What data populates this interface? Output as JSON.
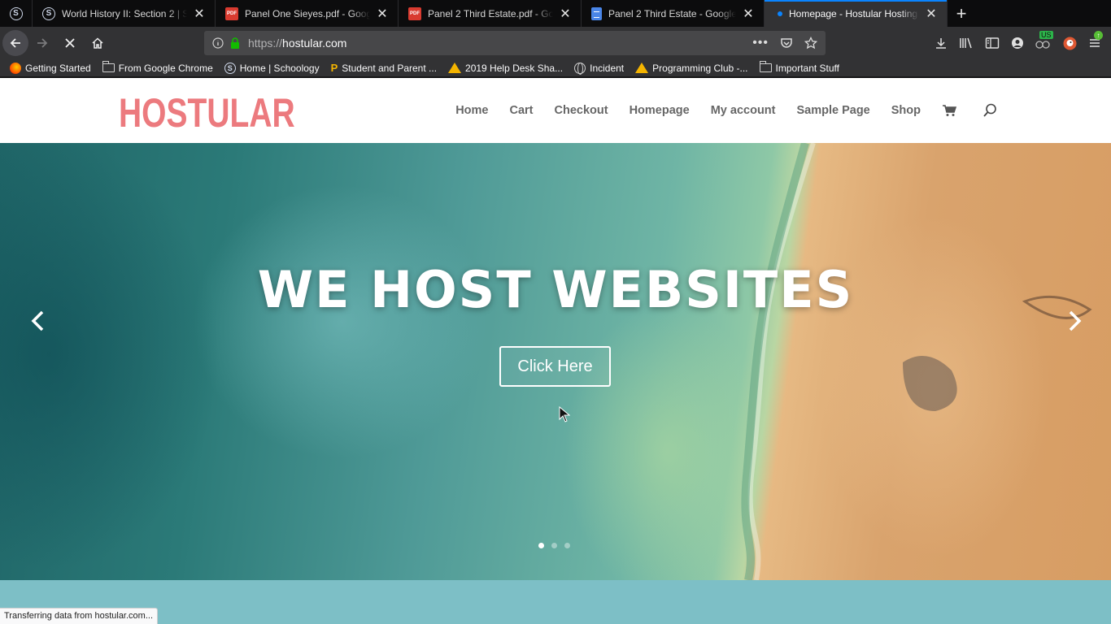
{
  "browser": {
    "tabs": [
      {
        "title": "World History II: Section 2 | Sch",
        "icon": "schoology-icon",
        "active": false
      },
      {
        "title": "Panel One Sieyes.pdf - Google",
        "icon": "pdf-icon",
        "active": false
      },
      {
        "title": "Panel 2 Third Estate.pdf - Goog",
        "icon": "pdf-icon",
        "active": false
      },
      {
        "title": "Panel 2 Third Estate - Google D",
        "icon": "google-docs-icon",
        "active": false
      },
      {
        "title": "Homepage - Hostular Hosting",
        "icon": "loading-dot-icon",
        "active": true
      }
    ],
    "url": {
      "protocol": "https://",
      "host": "hostular.com"
    },
    "extension_badge": "US",
    "bookmarks": [
      {
        "label": "Getting Started",
        "icon": "firefox-icon"
      },
      {
        "label": "From Google Chrome",
        "icon": "folder-icon"
      },
      {
        "label": "Home | Schoology",
        "icon": "schoology-icon"
      },
      {
        "label": "Student and Parent ...",
        "icon": "powerschool-icon"
      },
      {
        "label": "2019 Help Desk Sha...",
        "icon": "google-drive-icon"
      },
      {
        "label": "Incident",
        "icon": "globe-icon"
      },
      {
        "label": "Programming Club -...",
        "icon": "google-drive-icon"
      },
      {
        "label": "Important Stuff",
        "icon": "folder-icon"
      }
    ],
    "status_text": "Transferring data from hostular.com...",
    "colors": {
      "accent": "#0a84ff",
      "chrome": "#323234",
      "tabbar": "#0c0c0d"
    }
  },
  "site": {
    "logo": "HOSTULAR",
    "menu": [
      "Home",
      "Cart",
      "Checkout",
      "Homepage",
      "My account",
      "Sample Page",
      "Shop"
    ],
    "hero": {
      "title": "WE HOST WEBSITES",
      "button": "Click Here",
      "slides": 3,
      "active_slide": 1
    },
    "colors": {
      "logo": "#ec7a7e",
      "menu_text": "#666666",
      "band": "#7dbfc6"
    }
  }
}
